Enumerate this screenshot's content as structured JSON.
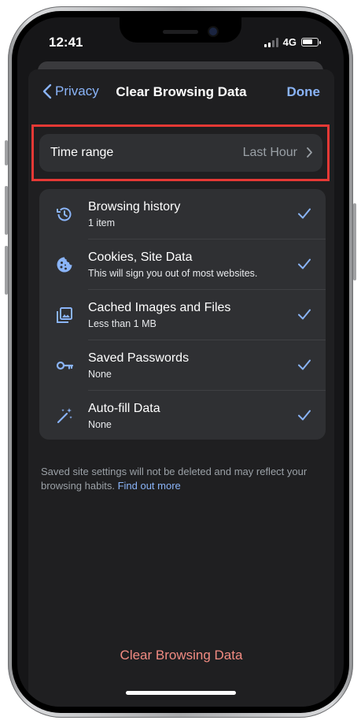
{
  "status_bar": {
    "time": "12:41",
    "network": "4G"
  },
  "nav": {
    "back_label": "Privacy",
    "title": "Clear Browsing Data",
    "done_label": "Done"
  },
  "time_range": {
    "label": "Time range",
    "value": "Last Hour"
  },
  "items": [
    {
      "title": "Browsing history",
      "subtitle": "1 item",
      "icon": "history-icon",
      "checked": true
    },
    {
      "title": "Cookies, Site Data",
      "subtitle": "This will sign you out of most websites.",
      "icon": "cookie-icon",
      "checked": true
    },
    {
      "title": "Cached Images and Files",
      "subtitle": "Less than 1 MB",
      "icon": "image-icon",
      "checked": true
    },
    {
      "title": "Saved Passwords",
      "subtitle": "None",
      "icon": "key-icon",
      "checked": true
    },
    {
      "title": "Auto-fill Data",
      "subtitle": "None",
      "icon": "magic-wand-icon",
      "checked": true
    }
  ],
  "footer": {
    "text": "Saved site settings will not be deleted and may reflect your browsing habits. ",
    "link": "Find out more"
  },
  "clear_button": {
    "label": "Clear Browsing Data"
  },
  "colors": {
    "accent": "#8ab4f8",
    "destructive": "#f28b82",
    "highlight": "#e53935",
    "background": "#1f1f21",
    "card": "#2f3033"
  }
}
